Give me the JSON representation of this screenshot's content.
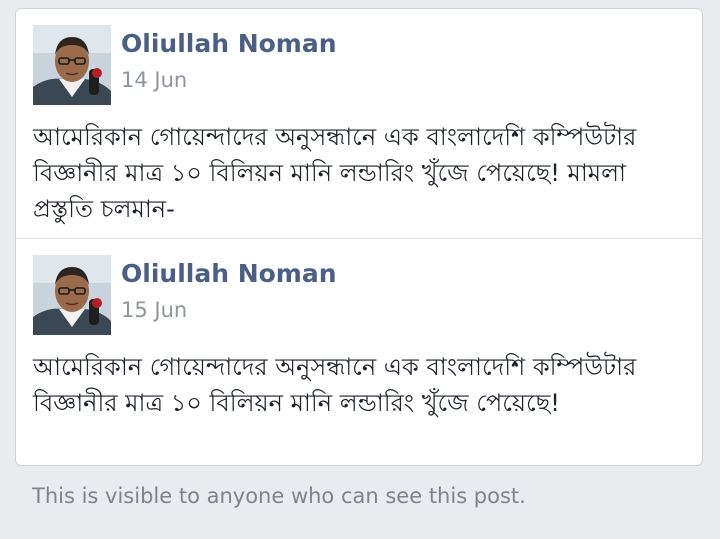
{
  "posts": [
    {
      "author": "Oliullah Noman",
      "date": "14 Jun",
      "text": "আমেরিকান গোয়েন্দাদের অনুসন্ধানে এক বাংলাদেশি কম্পিউটার বিজ্ঞানীর মাত্র ১০ বিলিয়ন মানি লন্ডারিং খুঁজে পেয়েছে! মামলা প্রস্তুতি চলমান-"
    },
    {
      "author": "Oliullah Noman",
      "date": "15 Jun",
      "text": "আমেরিকান গোয়েন্দাদের অনুসন্ধানে এক বাংলাদেশি কম্পিউটার বিজ্ঞানীর মাত্র ১০ বিলিয়ন মানি লন্ডারিং খুঁজে পেয়েছে!"
    }
  ],
  "footer_note": "This is visible to anyone who can see this post.",
  "colors": {
    "author_name": "#4b5f85",
    "date": "#90949c",
    "post_text": "#1d2129",
    "background": "#e9ebee"
  }
}
